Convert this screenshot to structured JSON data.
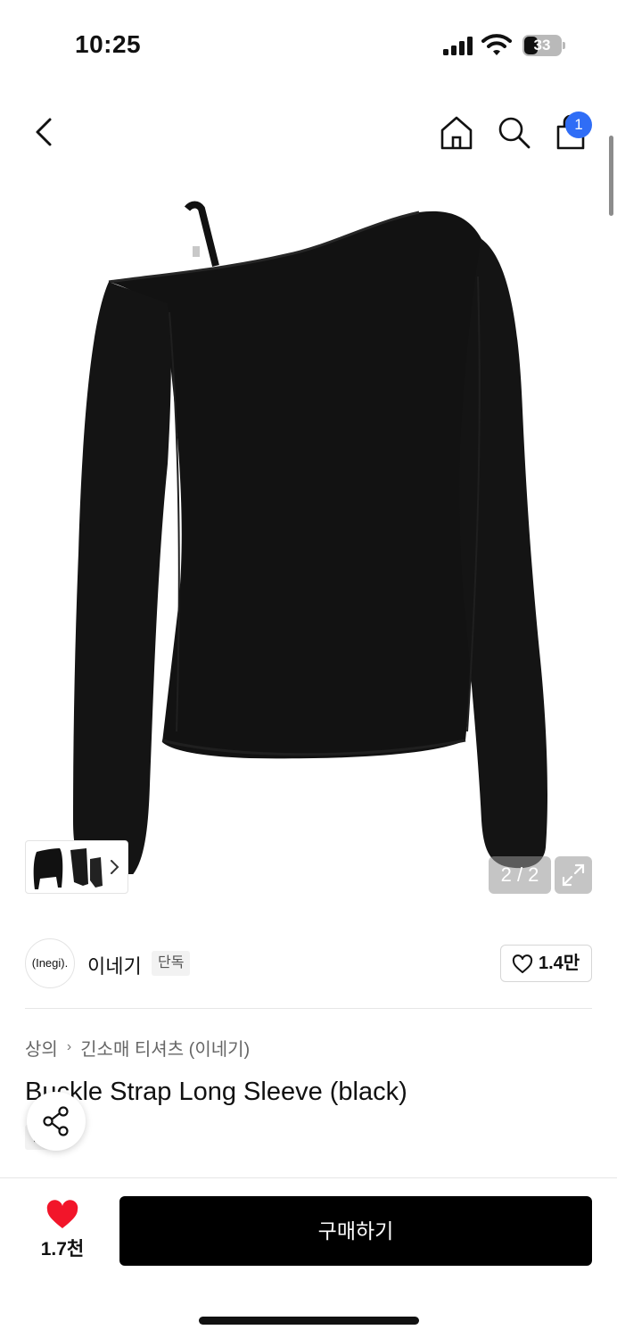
{
  "status_bar": {
    "time": "10:25",
    "battery": "33",
    "icons": [
      "signal-icon",
      "wifi-icon",
      "battery-icon"
    ]
  },
  "nav": {
    "icons": [
      "back-icon",
      "home-icon",
      "search-icon",
      "shopping-bag-icon"
    ],
    "cart_badge": "1"
  },
  "gallery": {
    "page_indicator": "2 / 2",
    "expand_icon": "expand-icon"
  },
  "brand": {
    "logo_text": "(Inegi).",
    "name": "이네기",
    "tag": "단독",
    "like_count": "1.4만"
  },
  "product": {
    "breadcrumb": [
      "상의",
      "긴소매 티셔츠 (이네기)"
    ],
    "title": "Buckle Strap Long Sleeve (black)",
    "exclusive_tag": "단독"
  },
  "bottom_bar": {
    "wish_count": "1.7천",
    "buy_label": "구매하기"
  },
  "colors": {
    "accent_blue": "#2f6df6",
    "heart_red": "#f2152a",
    "buy_button": "#000000"
  }
}
